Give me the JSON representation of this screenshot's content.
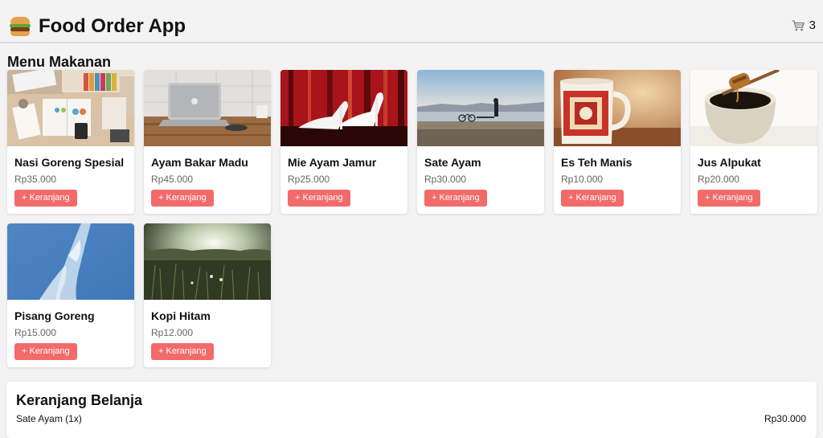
{
  "header": {
    "title": "Food Order App",
    "logo_icon": "burger-icon",
    "cart_icon": "shopping-cart-icon",
    "cart_count": "3"
  },
  "menu": {
    "title": "Menu Makanan",
    "add_label": "+ Keranjang",
    "accent_color": "#f26a6a",
    "items": [
      {
        "name": "Nasi Goreng Spesial",
        "price": "Rp35.000",
        "image": "desk-workspace-photo"
      },
      {
        "name": "Ayam Bakar Madu",
        "price": "Rp45.000",
        "image": "laptop-on-table-photo"
      },
      {
        "name": "Mie Ayam Jamur",
        "price": "Rp25.000",
        "image": "white-heels-photo"
      },
      {
        "name": "Sate Ayam",
        "price": "Rp30.000",
        "image": "seaside-silhouette-photo"
      },
      {
        "name": "Es Teh Manis",
        "price": "Rp10.000",
        "image": "vintage-mug-photo"
      },
      {
        "name": "Jus Alpukat",
        "price": "Rp20.000",
        "image": "honey-jar-photo"
      },
      {
        "name": "Pisang Goreng",
        "price": "Rp15.000",
        "image": "blue-sky-cloud-photo"
      },
      {
        "name": "Kopi Hitam",
        "price": "Rp12.000",
        "image": "sunlit-grass-field-photo"
      }
    ]
  },
  "cart": {
    "title": "Keranjang Belanja",
    "items": [
      {
        "label": "Sate Ayam (1x)",
        "price": "Rp30.000"
      }
    ]
  }
}
